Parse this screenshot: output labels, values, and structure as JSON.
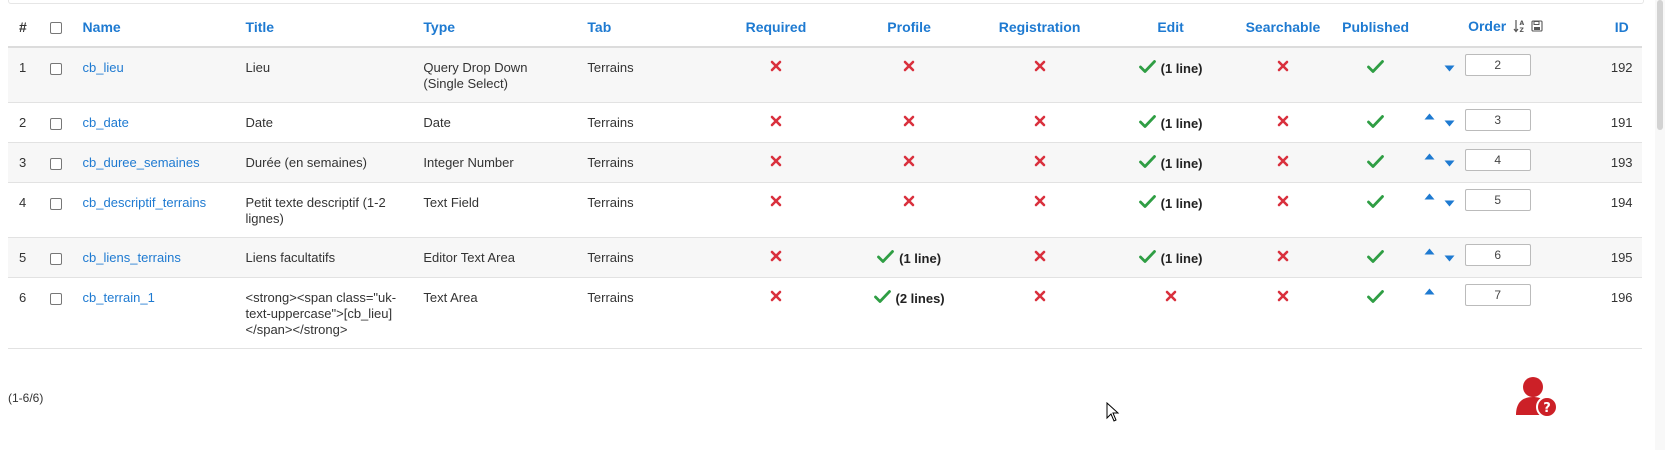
{
  "columns": {
    "hash": "#",
    "name": "Name",
    "title": "Title",
    "type": "Type",
    "tab": "Tab",
    "required": "Required",
    "profile": "Profile",
    "registration": "Registration",
    "edit": "Edit",
    "searchable": "Searchable",
    "published": "Published",
    "order": "Order",
    "id": "ID"
  },
  "rows": [
    {
      "n": "1",
      "name": "cb_lieu",
      "title": "Lieu",
      "type": "Query Drop Down (Single Select)",
      "tab": "Terrains",
      "required": "no",
      "profile": "no",
      "profile_text": "",
      "registration": "no",
      "edit": "yes",
      "edit_text": "(1 line)",
      "searchable": "no",
      "published": "yes",
      "up": false,
      "down": true,
      "order": "2",
      "id": "192"
    },
    {
      "n": "2",
      "name": "cb_date",
      "title": "Date",
      "type": "Date",
      "tab": "Terrains",
      "required": "no",
      "profile": "no",
      "profile_text": "",
      "registration": "no",
      "edit": "yes",
      "edit_text": "(1 line)",
      "searchable": "no",
      "published": "yes",
      "up": true,
      "down": true,
      "order": "3",
      "id": "191"
    },
    {
      "n": "3",
      "name": "cb_duree_semaines",
      "title": "Durée (en semaines)",
      "type": "Integer Number",
      "tab": "Terrains",
      "required": "no",
      "profile": "no",
      "profile_text": "",
      "registration": "no",
      "edit": "yes",
      "edit_text": "(1 line)",
      "searchable": "no",
      "published": "yes",
      "up": true,
      "down": true,
      "order": "4",
      "id": "193"
    },
    {
      "n": "4",
      "name": "cb_descriptif_terrains",
      "title": "Petit texte descriptif (1-2 lignes)",
      "type": "Text Field",
      "tab": "Terrains",
      "required": "no",
      "profile": "no",
      "profile_text": "",
      "registration": "no",
      "edit": "yes",
      "edit_text": "(1 line)",
      "searchable": "no",
      "published": "yes",
      "up": true,
      "down": true,
      "order": "5",
      "id": "194"
    },
    {
      "n": "5",
      "name": "cb_liens_terrains",
      "title": "Liens facultatifs",
      "type": "Editor Text Area",
      "tab": "Terrains",
      "required": "no",
      "profile": "yes",
      "profile_text": "(1 line)",
      "registration": "no",
      "edit": "yes",
      "edit_text": "(1 line)",
      "searchable": "no",
      "published": "yes",
      "up": true,
      "down": true,
      "order": "6",
      "id": "195"
    },
    {
      "n": "6",
      "name": "cb_terrain_1",
      "title": "<strong><span class=\"uk-text-uppercase\">[cb_lieu]</span></strong>",
      "type": "Text Area",
      "tab": "Terrains",
      "required": "no",
      "profile": "yes",
      "profile_text": "(2 lines)",
      "registration": "no",
      "edit": "no",
      "edit_text": "",
      "searchable": "no",
      "published": "yes",
      "up": true,
      "down": false,
      "order": "7",
      "id": "196"
    }
  ],
  "pagination": "(1-6/6)",
  "colors": {
    "link": "#1e7ad1",
    "yes": "#2f9e44",
    "no": "#d9303d",
    "help": "#cc2027"
  },
  "icons": {
    "yes": "check-icon",
    "no": "cross-icon",
    "up": "arrow-up-icon",
    "down": "arrow-down-icon",
    "sort": "sort-alpha-icon",
    "save": "save-icon",
    "help": "help-user-icon"
  }
}
